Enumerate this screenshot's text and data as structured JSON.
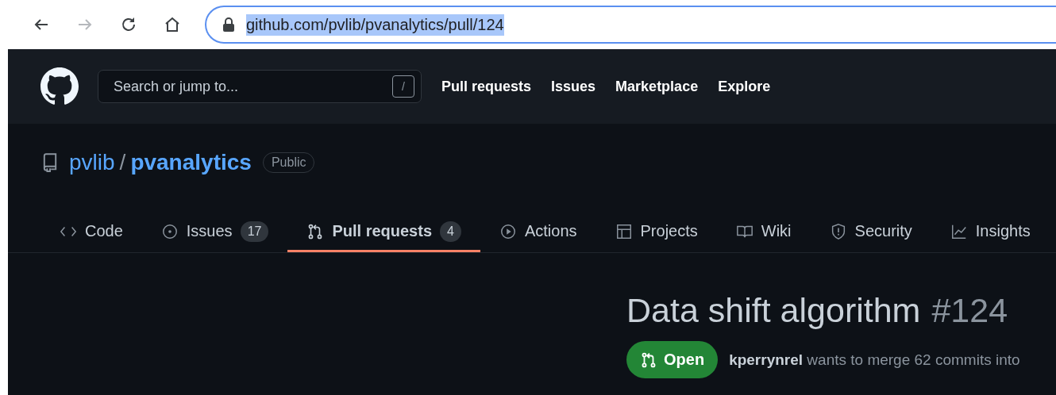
{
  "browser": {
    "nav_buttons": [
      {
        "kind": "back",
        "disabled": false
      },
      {
        "kind": "forward",
        "disabled": true
      },
      {
        "kind": "reload",
        "disabled": false
      },
      {
        "kind": "home",
        "disabled": false
      }
    ],
    "address_bar": {
      "url": "github.com/pvlib/pvanalytics/pull/124",
      "selected": true
    }
  },
  "header": {
    "search": {
      "placeholder": "Search or jump to...",
      "shortcut": "/"
    },
    "links": [
      "Pull requests",
      "Issues",
      "Marketplace",
      "Explore"
    ]
  },
  "repo": {
    "owner": "pvlib",
    "separator": "/",
    "name": "pvanalytics",
    "visibility": "Public"
  },
  "tabs": [
    {
      "label": "Code",
      "selected": false
    },
    {
      "label": "Issues",
      "count": "17",
      "selected": false
    },
    {
      "label": "Pull requests",
      "count": "4",
      "selected": true
    },
    {
      "label": "Actions",
      "selected": false
    },
    {
      "label": "Projects",
      "selected": false
    },
    {
      "label": "Wiki",
      "selected": false
    },
    {
      "label": "Security",
      "selected": false
    },
    {
      "label": "Insights",
      "selected": false
    }
  ],
  "pull_request": {
    "title": "Data shift algorithm",
    "number": "#124",
    "state": "Open",
    "summary": "**kperrynrel** wants to merge 62 commits into"
  }
}
